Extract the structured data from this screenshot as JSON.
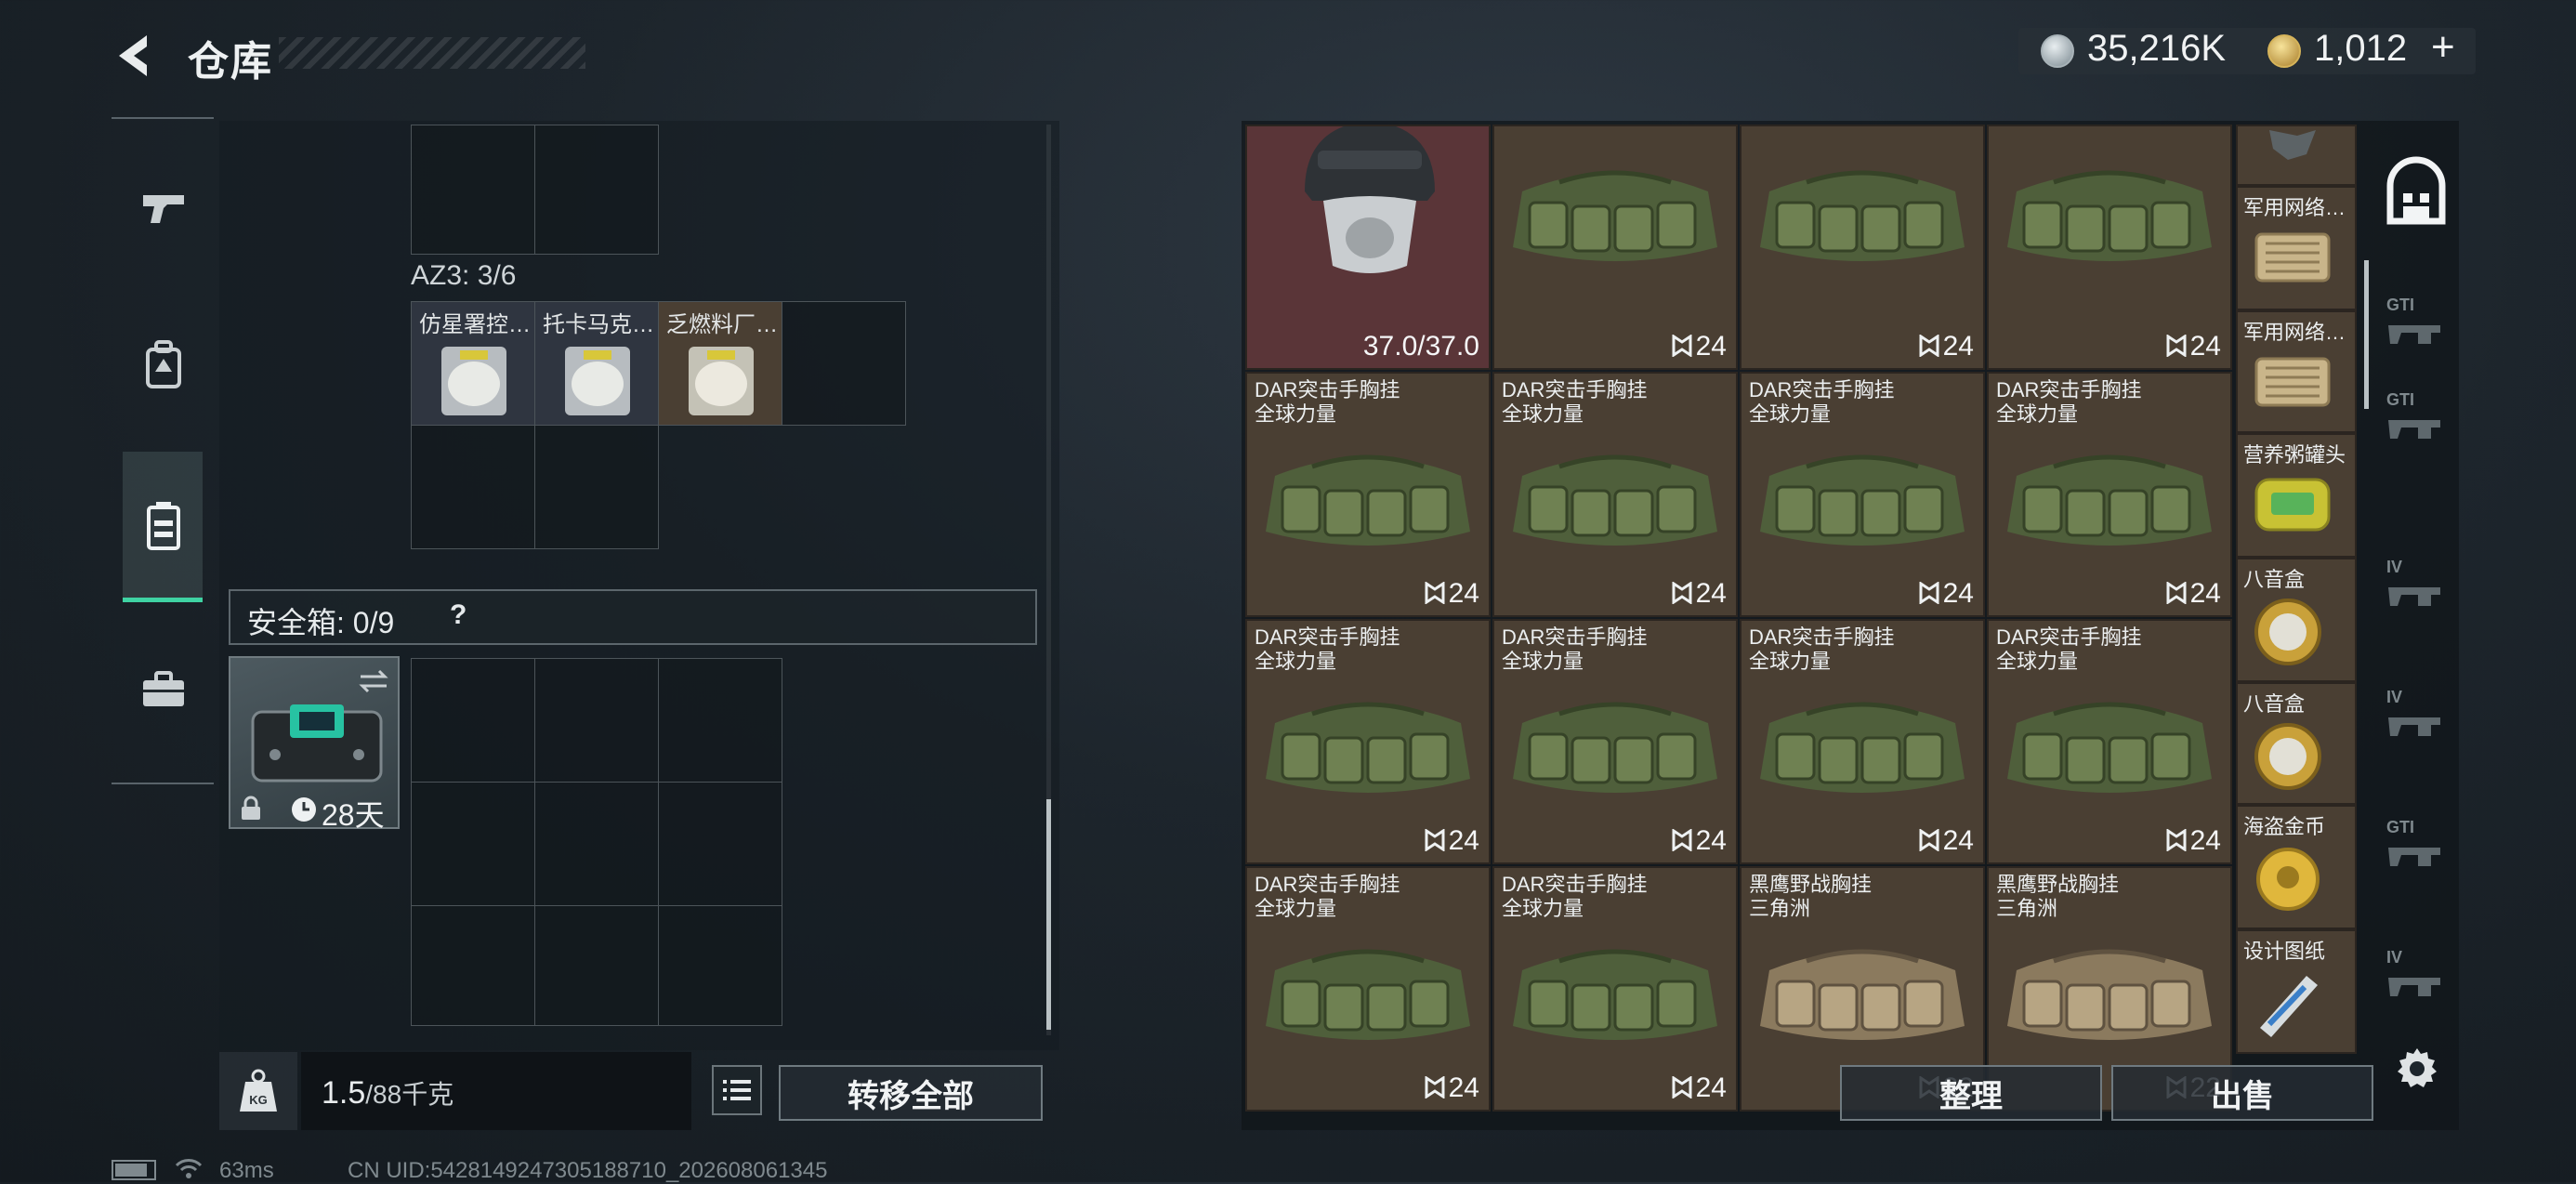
{
  "header": {
    "title": "仓库",
    "silver_amount": "35,216K",
    "gold_amount": "1,012",
    "gold_add": "+"
  },
  "left": {
    "az3_label": "AZ3: 3/6",
    "az3_items": [
      {
        "name": "仿星署控…"
      },
      {
        "name": "托卡马克…"
      },
      {
        "name": "乏燃料厂…"
      }
    ],
    "safe": {
      "label": "安全箱: 0/9",
      "help": "?",
      "timer": "28天"
    },
    "weight": "1.5",
    "weight_unit": "/88千克",
    "transfer_all": "转移全部"
  },
  "right": {
    "first_item_durability": "37.0/37.0",
    "grid": [
      [
        {
          "name": "",
          "sub": "",
          "qty": "",
          "type": "helmet"
        },
        {
          "name": "",
          "sub": "",
          "qty": "24",
          "type": "bag-green"
        },
        {
          "name": "",
          "sub": "",
          "qty": "24",
          "type": "bag-green"
        },
        {
          "name": "",
          "sub": "",
          "qty": "24",
          "type": "bag-green"
        }
      ],
      [
        {
          "name": "DAR突击手胸挂",
          "sub": "全球力量",
          "qty": "24",
          "type": "bag-green"
        },
        {
          "name": "DAR突击手胸挂",
          "sub": "全球力量",
          "qty": "24",
          "type": "bag-green"
        },
        {
          "name": "DAR突击手胸挂",
          "sub": "全球力量",
          "qty": "24",
          "type": "bag-green"
        },
        {
          "name": "DAR突击手胸挂",
          "sub": "全球力量",
          "qty": "24",
          "type": "bag-green"
        }
      ],
      [
        {
          "name": "DAR突击手胸挂",
          "sub": "全球力量",
          "qty": "24",
          "type": "bag-green"
        },
        {
          "name": "DAR突击手胸挂",
          "sub": "全球力量",
          "qty": "24",
          "type": "bag-green"
        },
        {
          "name": "DAR突击手胸挂",
          "sub": "全球力量",
          "qty": "24",
          "type": "bag-green"
        },
        {
          "name": "DAR突击手胸挂",
          "sub": "全球力量",
          "qty": "24",
          "type": "bag-green"
        }
      ],
      [
        {
          "name": "DAR突击手胸挂",
          "sub": "全球力量",
          "qty": "24",
          "type": "bag-green"
        },
        {
          "name": "DAR突击手胸挂",
          "sub": "全球力量",
          "qty": "24",
          "type": "bag-green"
        },
        {
          "name": "黑鹰野战胸挂",
          "sub": "三角洲",
          "qty": "22",
          "type": "bag-tan"
        },
        {
          "name": "黑鹰野战胸挂",
          "sub": "三角洲",
          "qty": "22",
          "type": "bag-tan"
        }
      ]
    ],
    "side_items": [
      {
        "name": ""
      },
      {
        "name": "军用网络…"
      },
      {
        "name": "军用网络…"
      },
      {
        "name": "营养粥罐头"
      },
      {
        "name": "八音盒"
      },
      {
        "name": "八音盒"
      },
      {
        "name": "海盗金币"
      },
      {
        "name": "设计图纸"
      }
    ],
    "sort_label": "整理",
    "sell_label": "出售",
    "category_labels": [
      "GTI",
      "GTI",
      "IV",
      "IV",
      "GTI",
      "IV"
    ]
  },
  "status": {
    "ping": "63ms",
    "uid": "CN UID:5428149247305188710_202608061345"
  }
}
